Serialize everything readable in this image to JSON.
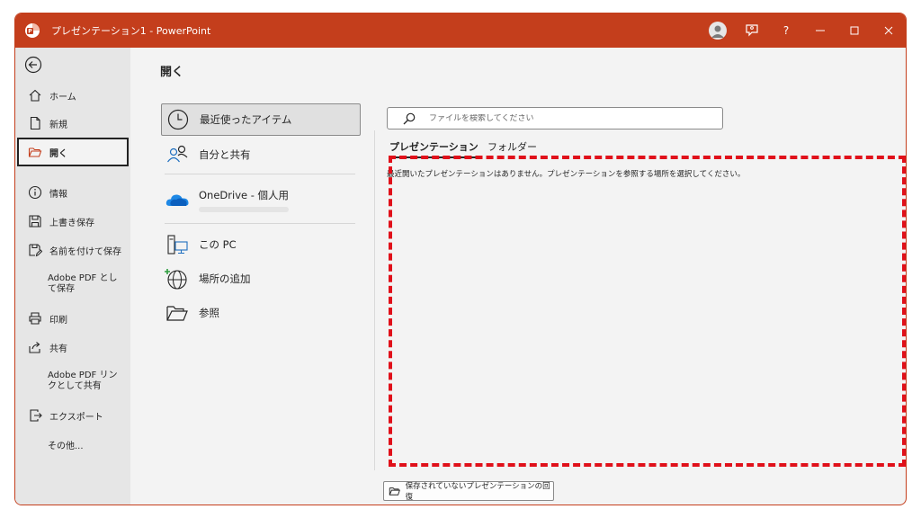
{
  "titlebar": {
    "title": "プレゼンテーション1  -  PowerPoint",
    "accent": "#c43e1c",
    "help_label": "?"
  },
  "sidebar": {
    "items": [
      {
        "label": "ホーム",
        "icon": "home-icon"
      },
      {
        "label": "新規",
        "icon": "new-document-icon"
      },
      {
        "label": "開く",
        "icon": "open-folder-icon"
      },
      {
        "label": "情報",
        "icon": "info-icon"
      },
      {
        "label": "上書き保存",
        "icon": "save-icon"
      },
      {
        "label": "名前を付けて保存",
        "icon": "save-as-icon"
      },
      {
        "label": "Adobe PDF として保存"
      },
      {
        "label": "印刷",
        "icon": "print-icon"
      },
      {
        "label": "共有",
        "icon": "share-icon"
      },
      {
        "label": "Adobe PDF リンクとして共有"
      },
      {
        "label": "エクスポート",
        "icon": "export-icon"
      },
      {
        "label": "その他..."
      }
    ]
  },
  "main": {
    "title": "開く",
    "locations": [
      {
        "label": "最近使ったアイテム",
        "icon": "clock-icon"
      },
      {
        "label": "自分と共有",
        "icon": "people-icon"
      },
      {
        "label": "OneDrive - 個人用",
        "icon": "onedrive-icon"
      },
      {
        "label": "この PC",
        "icon": "pc-icon"
      },
      {
        "label": "場所の追加",
        "icon": "globe-add-icon"
      },
      {
        "label": "参照",
        "icon": "folder-icon"
      }
    ],
    "search_placeholder": "ファイルを検索してください",
    "tabs": [
      {
        "label": "プレゼンテーション",
        "active": true
      },
      {
        "label": "フォルダー",
        "active": false
      }
    ],
    "empty_message": "最近開いたプレゼンテーションはありません。プレゼンテーションを参照する場所を選択してください。",
    "recover_button": "保存されていないプレゼンテーションの回復",
    "highlight_color": "#e0101a"
  }
}
